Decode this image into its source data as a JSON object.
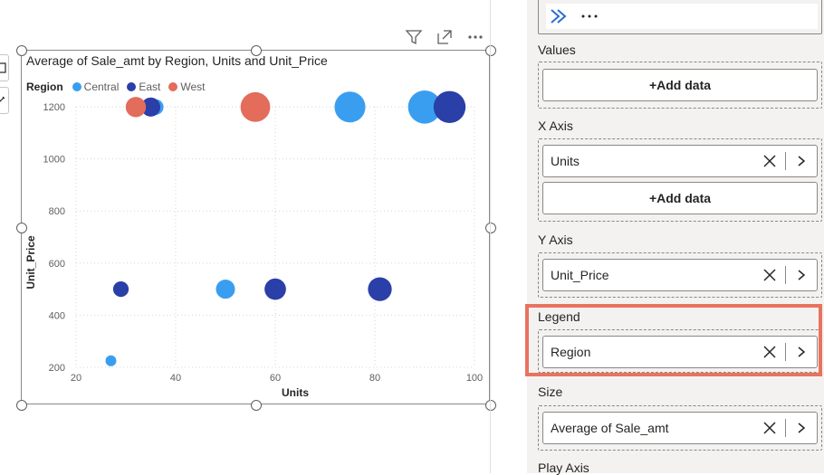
{
  "visual": {
    "title": "Average of Sale_amt by Region, Units and Unit_Price"
  },
  "legend": {
    "title": "Region",
    "items": [
      {
        "label": "Central",
        "color": "#3a9ef0"
      },
      {
        "label": "East",
        "color": "#2b3fa8"
      },
      {
        "label": "West",
        "color": "#e36c5a"
      }
    ]
  },
  "chart_data": {
    "type": "scatter",
    "title": "Average of Sale_amt by Region, Units and Unit_Price",
    "xlabel": "Units",
    "ylabel": "Unit_Price",
    "xlim": [
      20,
      100
    ],
    "ylim": [
      200,
      1200
    ],
    "xticks": [
      "20",
      "40",
      "60",
      "80",
      "100"
    ],
    "yticks": [
      "200",
      "400",
      "600",
      "800",
      "1000",
      "1200"
    ],
    "grid": true,
    "legend_position": "top-left",
    "series": [
      {
        "name": "Central",
        "color": "#3a9ef0",
        "points": [
          {
            "x": 27,
            "y": 225,
            "size": 1.0
          },
          {
            "x": 36,
            "y": 1199,
            "size": 1.4
          },
          {
            "x": 50,
            "y": 500,
            "size": 1.7
          },
          {
            "x": 75,
            "y": 1199,
            "size": 2.7
          },
          {
            "x": 90,
            "y": 1199,
            "size": 2.9
          }
        ]
      },
      {
        "name": "East",
        "color": "#2b3fa8",
        "points": [
          {
            "x": 29,
            "y": 500,
            "size": 1.4
          },
          {
            "x": 35,
            "y": 1199,
            "size": 1.7
          },
          {
            "x": 60,
            "y": 500,
            "size": 1.9
          },
          {
            "x": 81,
            "y": 500,
            "size": 2.1
          },
          {
            "x": 95,
            "y": 1199,
            "size": 2.8
          }
        ]
      },
      {
        "name": "West",
        "color": "#e36c5a",
        "points": [
          {
            "x": 32,
            "y": 1199,
            "size": 1.8
          },
          {
            "x": 56,
            "y": 1199,
            "size": 2.6
          }
        ]
      }
    ]
  },
  "pane": {
    "values_label": "Values",
    "add_data_label": "+Add data",
    "xaxis_label": "X Axis",
    "xaxis_field": "Units",
    "yaxis_label": "Y Axis",
    "yaxis_field": "Unit_Price",
    "legend_label": "Legend",
    "legend_field": "Region",
    "size_label": "Size",
    "size_field": "Average of Sale_amt",
    "play_axis_label": "Play Axis"
  },
  "accent": {
    "highlight": "#e8735f"
  }
}
